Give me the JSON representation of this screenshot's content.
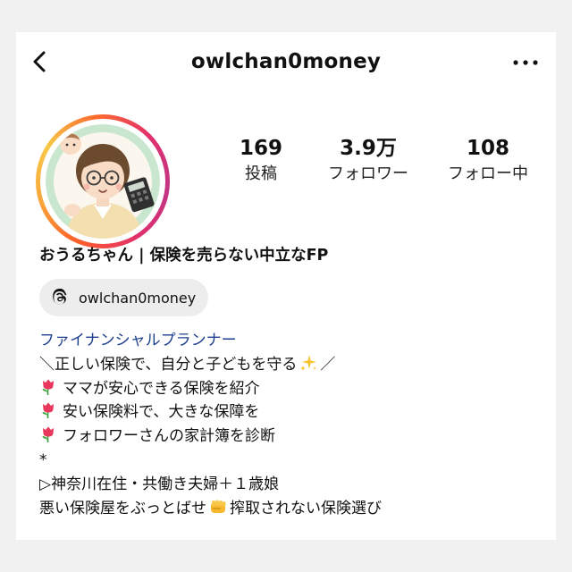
{
  "header": {
    "username": "owlchan0money",
    "back_icon": "chevron-left-icon",
    "more_icon": "more-horizontal-icon"
  },
  "stats": [
    {
      "value": "169",
      "label": "投稿"
    },
    {
      "value": "3.9万",
      "label": "フォロワー"
    },
    {
      "value": "108",
      "label": "フォロー中"
    }
  ],
  "profile": {
    "display_name": "おうるちゃん | 保険を売らない中立なFP",
    "threads_handle": "owlchan0money",
    "category": "ファイナンシャルプランナー",
    "bio": {
      "line1_a": "＼正しい保険で、自分と子どもを守る",
      "line1_b": "／",
      "item1": "ママが安心できる保険を紹介",
      "item2": "安い保険料で、大きな保障を",
      "item3": "フォロワーさんの家計簿を診断",
      "separator": "*",
      "line_location": "▷神奈川在住・共働き夫婦＋１歳娘",
      "line_last_a": "悪い保険屋をぶっとばせ",
      "line_last_b": "搾取されない保険選び"
    }
  },
  "colors": {
    "story_ring": [
      "#fd5c2b",
      "#f9a53a",
      "#e1306c",
      "#c13584"
    ],
    "category_link": "#1f3f8f",
    "chip_bg": "#ededed"
  }
}
